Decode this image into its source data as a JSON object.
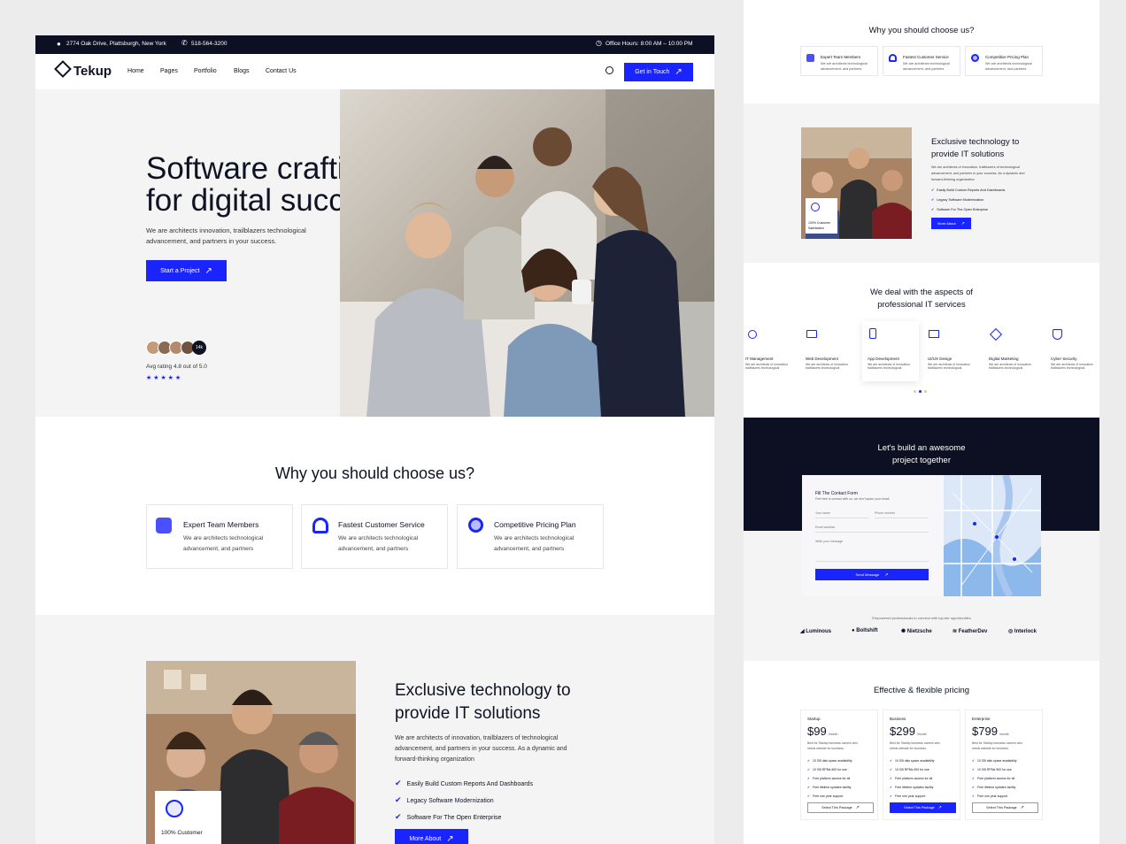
{
  "topbar": {
    "address": "2774 Oak Drive, Plattsburgh, New York",
    "phone": "518-564-3200",
    "hours": "Office Hours: 8:00 AM – 10:00 PM"
  },
  "nav": {
    "logo": "Tekup",
    "items": [
      "Home",
      "Pages",
      "Portfolio",
      "Blogs",
      "Contact Us"
    ],
    "cta": "Get in Touch"
  },
  "hero": {
    "title_line1": "Software crafting",
    "title_line2": "for digital success",
    "desc_line1": "We are architects innovation, trailblazers technological",
    "desc_line2": "advancement, and partners in your success.",
    "cta": "Start a Project",
    "avatar_count": "14k",
    "rating": "Avg rating 4.8 out of 5.0",
    "stars": "★ ★ ★ ★ ★"
  },
  "choose": {
    "title": "Why you should choose us?",
    "cards": [
      {
        "title": "Expert Team Members",
        "desc1": "We are architects technological",
        "desc2": "advancement, and partners",
        "icon": "team-icon"
      },
      {
        "title": "Fastest Customer Service",
        "desc1": "We are architects technological",
        "desc2": "advancement, and partners",
        "icon": "headset-icon"
      },
      {
        "title": "Competitive Pricing Plan",
        "desc1": "We are architects technological",
        "desc2": "advancement, and partners",
        "icon": "price-icon"
      }
    ]
  },
  "about": {
    "title_line1": "Exclusive technology to",
    "title_line2": "provide IT solutions",
    "desc1": "We are architects of innovation, trailblazers of technological",
    "desc2": "advancement, and partners in your success. As a dynamic and",
    "desc3": "forward-thinking organization",
    "bullets": [
      "Easily Build Custom Reports And Dashboards",
      "Legacy Software Modernization",
      "Software For The Open Enterprise"
    ],
    "cta": "More About",
    "badge1": "100% Customer",
    "badge2": "Satisfaction"
  },
  "services": {
    "title_line1": "We deal with the aspects of",
    "title_line2": "professional IT services",
    "items": [
      {
        "name": "IT Management",
        "icon": "it-icon"
      },
      {
        "name": "Web Development",
        "icon": "web-icon"
      },
      {
        "name": "App Development",
        "icon": "app-icon"
      },
      {
        "name": "UI/UX Design",
        "icon": "design-icon"
      },
      {
        "name": "Digital Marketing",
        "icon": "marketing-icon"
      },
      {
        "name": "Cyber Security",
        "icon": "security-icon"
      }
    ],
    "desc": "We are architects of innovation trailblazers technological"
  },
  "contact": {
    "title_line1": "Let's build an awesome",
    "title_line2": "project together",
    "form_title": "Fill The Contact Form",
    "form_sub": "Feel free to contact with us, we don't spam your email",
    "name": "Your name",
    "phone": "Phone number",
    "email": "Email address",
    "message": "Write your message",
    "send": "Send Message"
  },
  "partners": {
    "caption": "Empowered professionals to connect with top-tier opportunities",
    "logos": [
      "Luminous",
      "Boltshift",
      "Nietzsche",
      "FeatherDev",
      "Interlock"
    ]
  },
  "pricing": {
    "title": "Effective & flexible pricing",
    "plans": [
      {
        "name": "Startup",
        "price": "$99",
        "period": "/month",
        "desc1": "Best for Startup business owners who",
        "desc2": "needs website for business.",
        "cta": "Select This Package"
      },
      {
        "name": "Business",
        "price": "$299",
        "period": "/month",
        "desc1": "Best for Startup business owners who",
        "desc2": "needs website for business.",
        "cta": "Select This Package"
      },
      {
        "name": "Enterprise",
        "price": "$799",
        "period": "/month",
        "desc1": "Best for Startup business owners who",
        "desc2": "needs website for business.",
        "cta": "Select This Package"
      }
    ],
    "features": [
      "10 GB disk space availability",
      "10 GB RPMs 500 for use",
      "Free platform access for all",
      "Free lifetime updates facility",
      "Free one year support"
    ]
  },
  "colors": {
    "accent": "#1a24ff",
    "dark": "#0d1022"
  }
}
